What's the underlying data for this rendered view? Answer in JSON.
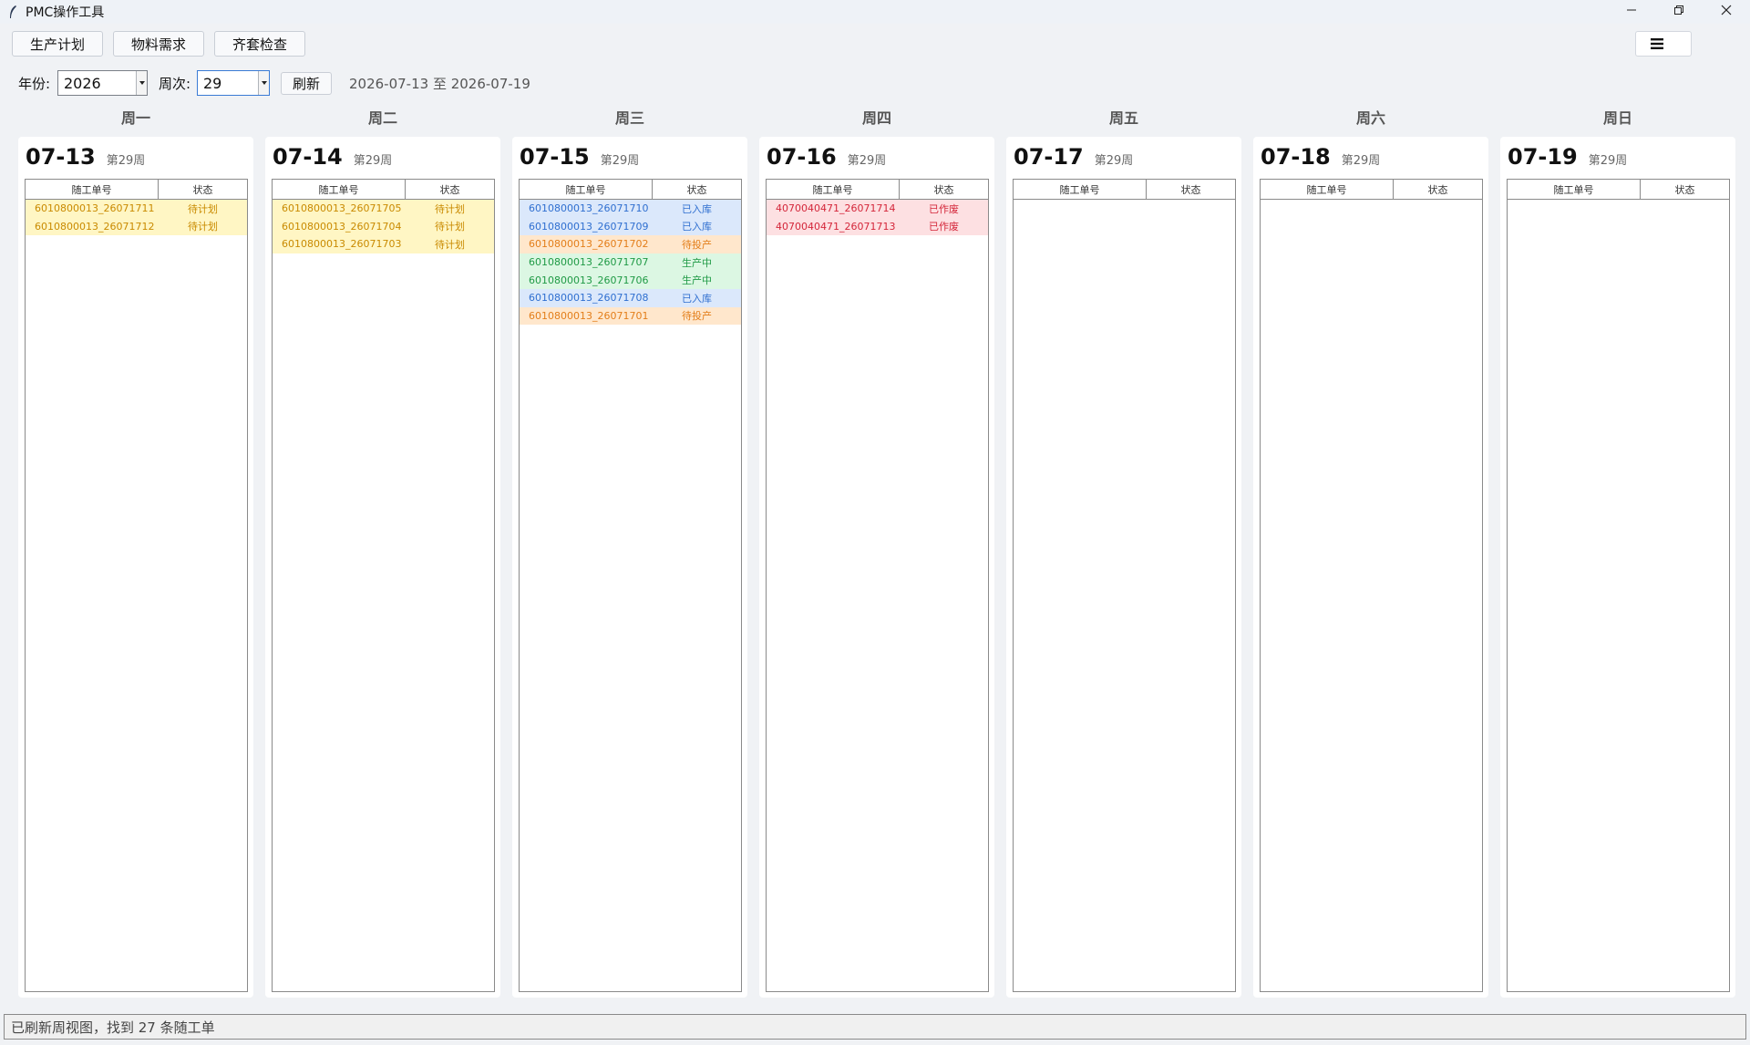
{
  "window": {
    "title": "PMC操作工具"
  },
  "toolbar": {
    "buttons": [
      "生产计划",
      "物料需求",
      "齐套检查"
    ],
    "menu_icon": "hamburger-icon"
  },
  "filter": {
    "year_label": "年份:",
    "year_value": "2026",
    "week_label": "周次:",
    "week_value": "29",
    "refresh_label": "刷新",
    "range_text": "2026-07-13 至 2026-07-19"
  },
  "table_headers": {
    "order": "随工单号",
    "status": "状态"
  },
  "status_colors": {
    "待计划": {
      "bg": "#fff6c4",
      "fg": "#c98a00"
    },
    "已入库": {
      "bg": "#dbe8fb",
      "fg": "#2f6fd0"
    },
    "待投产": {
      "bg": "#ffe7cc",
      "fg": "#e37e1a"
    },
    "生产中": {
      "bg": "#dcf7e3",
      "fg": "#1f9a45"
    },
    "已作废": {
      "bg": "#fde0e2",
      "fg": "#d4263a"
    }
  },
  "days": [
    {
      "weekday": "周一",
      "date": "07-13",
      "week": "第29周",
      "rows": [
        {
          "order": "6010800013_26071711",
          "status": "待计划"
        },
        {
          "order": "6010800013_26071712",
          "status": "待计划"
        }
      ]
    },
    {
      "weekday": "周二",
      "date": "07-14",
      "week": "第29周",
      "rows": [
        {
          "order": "6010800013_26071705",
          "status": "待计划"
        },
        {
          "order": "6010800013_26071704",
          "status": "待计划"
        },
        {
          "order": "6010800013_26071703",
          "status": "待计划"
        }
      ]
    },
    {
      "weekday": "周三",
      "date": "07-15",
      "week": "第29周",
      "rows": [
        {
          "order": "6010800013_26071710",
          "status": "已入库"
        },
        {
          "order": "6010800013_26071709",
          "status": "已入库"
        },
        {
          "order": "6010800013_26071702",
          "status": "待投产"
        },
        {
          "order": "6010800013_26071707",
          "status": "生产中"
        },
        {
          "order": "6010800013_26071706",
          "status": "生产中"
        },
        {
          "order": "6010800013_26071708",
          "status": "已入库"
        },
        {
          "order": "6010800013_26071701",
          "status": "待投产"
        }
      ]
    },
    {
      "weekday": "周四",
      "date": "07-16",
      "week": "第29周",
      "rows": [
        {
          "order": "4070040471_26071714",
          "status": "已作废"
        },
        {
          "order": "4070040471_26071713",
          "status": "已作废"
        }
      ]
    },
    {
      "weekday": "周五",
      "date": "07-17",
      "week": "第29周",
      "rows": []
    },
    {
      "weekday": "周六",
      "date": "07-18",
      "week": "第29周",
      "rows": []
    },
    {
      "weekday": "周日",
      "date": "07-19",
      "week": "第29周",
      "rows": []
    }
  ],
  "statusbar": {
    "text": "已刷新周视图，找到 27 条随工单"
  }
}
